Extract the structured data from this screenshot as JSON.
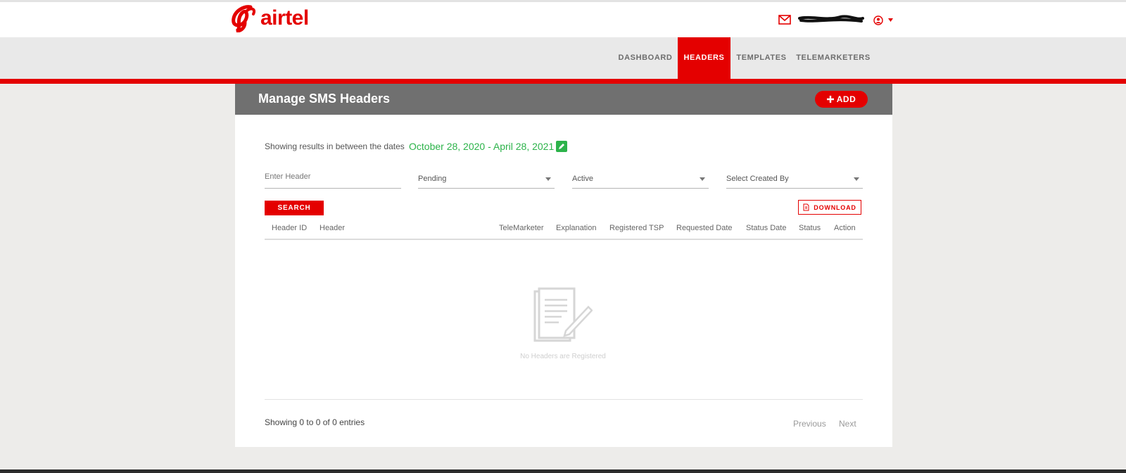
{
  "brand": {
    "name": "airtel",
    "color": "#e40000"
  },
  "header": {
    "icons": [
      "mail-icon",
      "user-icon",
      "caret-down-icon"
    ]
  },
  "nav": {
    "items": [
      {
        "label": "DASHBOARD",
        "active": false
      },
      {
        "label": "HEADERS",
        "active": true
      },
      {
        "label": "TEMPLATES",
        "active": false
      },
      {
        "label": "TELEMARKETERS",
        "active": false
      }
    ]
  },
  "page": {
    "title": "Manage SMS Headers",
    "add_label": "ADD"
  },
  "filters": {
    "range_label": "Showing results in between the dates",
    "range_value": "October 28, 2020 - April 28, 2021",
    "header_placeholder": "Enter Header",
    "status_value": "Pending",
    "state_value": "Active",
    "created_by_value": "Select Created By",
    "search_label": "SEARCH",
    "download_label": "DOWNLOAD"
  },
  "table": {
    "columns": [
      "Header ID",
      "Header",
      "TeleMarketer",
      "Explanation",
      "Registered TSP",
      "Requested Date",
      "Status Date",
      "Status",
      "Action"
    ],
    "rows": [],
    "empty_message": "No Headers are Registered"
  },
  "footer": {
    "entries_text": "Showing 0 to 0 of 0 entries",
    "previous_label": "Previous",
    "next_label": "Next"
  },
  "colors": {
    "accent": "#e40000",
    "success": "#2cb34a",
    "header_bg": "#707070",
    "nav_bg": "#e9e9e9"
  }
}
